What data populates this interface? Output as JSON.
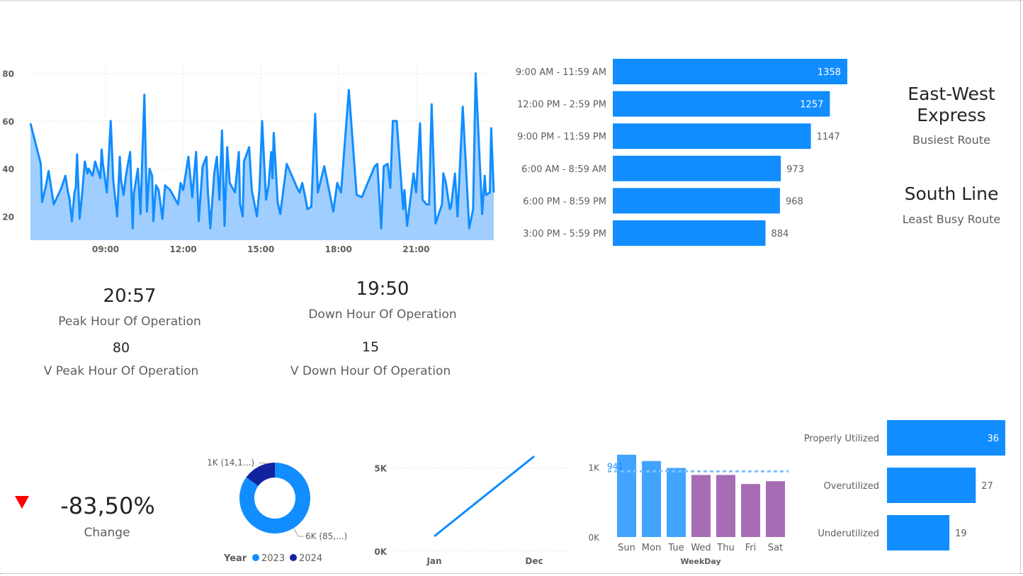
{
  "colors": {
    "primary": "#118DFF",
    "area_fill": "#A0CFFF",
    "dark_blue": "#12239E",
    "purple": "#A66CB4",
    "light_blue": "#41A4FF",
    "down_arrow": "#FF0000",
    "average_line": "#7CC0FF"
  },
  "routes": {
    "busiest": {
      "name": "East-West Express",
      "label": "Busiest Route"
    },
    "least_busy": {
      "name": "South Line",
      "label": "Least Busy Route"
    }
  },
  "kpis": {
    "peak_hour": {
      "value": "20:57",
      "label": "Peak Hour Of Operation"
    },
    "down_hour": {
      "value": "19:50",
      "label": "Down Hour Of Operation"
    },
    "v_peak": {
      "value": "80",
      "label": "V Peak Hour Of Operation"
    },
    "v_down": {
      "value": "15",
      "label": "V Down Hour Of Operation"
    },
    "change": {
      "value": "-83,50%",
      "label": "Change",
      "arrow_icon": "down-triangle-icon"
    }
  },
  "chart_data": [
    {
      "id": "hourly",
      "type": "area",
      "x_range": [
        6.1,
        24.0
      ],
      "ylim": [
        10,
        84
      ],
      "yticks": [
        20,
        40,
        60,
        80
      ],
      "xticks": [
        9,
        12,
        15,
        18,
        21
      ],
      "xtick_labels": [
        "09:00",
        "12:00",
        "15:00",
        "18:00",
        "21:00"
      ],
      "grid": true,
      "x": [
        6.1,
        6.5,
        6.55,
        6.7,
        6.8,
        7.0,
        7.3,
        7.45,
        7.55,
        7.6,
        7.7,
        7.8,
        7.85,
        7.9,
        8.0,
        8.1,
        8.2,
        8.3,
        8.35,
        8.5,
        8.6,
        8.8,
        8.85,
        8.9,
        9.05,
        9.2,
        9.3,
        9.45,
        9.55,
        9.6,
        9.7,
        9.8,
        9.95,
        10.05,
        10.1,
        10.25,
        10.35,
        10.45,
        10.5,
        10.6,
        10.7,
        10.8,
        10.85,
        10.95,
        11.05,
        11.1,
        11.2,
        11.3,
        11.5,
        11.8,
        11.9,
        12.0,
        12.2,
        12.35,
        12.5,
        12.6,
        12.75,
        12.9,
        12.95,
        13.05,
        13.2,
        13.3,
        13.4,
        13.5,
        13.6,
        13.7,
        13.8,
        14.0,
        14.15,
        14.2,
        14.3,
        14.35,
        14.55,
        14.65,
        14.85,
        14.95,
        15.05,
        15.2,
        15.3,
        15.4,
        15.45,
        15.5,
        15.65,
        15.75,
        16.0,
        16.4,
        16.5,
        16.6,
        16.7,
        16.8,
        16.95,
        17.1,
        17.2,
        17.45,
        17.8,
        17.95,
        18.1,
        18.4,
        18.7,
        18.9,
        19.4,
        19.5,
        19.65,
        19.75,
        19.9,
        20.0,
        20.1,
        20.25,
        20.5,
        20.55,
        20.65,
        20.8,
        20.9,
        21.0,
        21.15,
        21.25,
        21.4,
        21.5,
        21.55,
        21.6,
        21.75,
        22.0,
        22.05,
        22.15,
        22.3,
        22.35,
        22.5,
        22.6,
        22.7,
        22.8,
        23.05,
        23.2,
        23.3,
        23.55,
        23.65,
        23.7,
        23.85,
        23.9,
        24.0
      ],
      "values": [
        59,
        42,
        26,
        33,
        39,
        25,
        32,
        37,
        30,
        28,
        18,
        30,
        32,
        46,
        19,
        30,
        43,
        38,
        40,
        37,
        43,
        36,
        48,
        42,
        30,
        60,
        35,
        20,
        45,
        35,
        29,
        38,
        47,
        15,
        30,
        40,
        21,
        54,
        71,
        22,
        40,
        37,
        18,
        33,
        31,
        27,
        19,
        33,
        31,
        25,
        34,
        31,
        45,
        28,
        47,
        18,
        41,
        45,
        31,
        15,
        38,
        45,
        27,
        56,
        16,
        49,
        34,
        30,
        47,
        25,
        20,
        43,
        49,
        31,
        20,
        32,
        60,
        27,
        33,
        47,
        36,
        55,
        26,
        21,
        42,
        32,
        30,
        34,
        29,
        23,
        24,
        63,
        30,
        41,
        22,
        34,
        30,
        73,
        29,
        28,
        41,
        42,
        15,
        41,
        42,
        32,
        60,
        60,
        23,
        31,
        16,
        29,
        38,
        30,
        59,
        27,
        25,
        25,
        47,
        67,
        17,
        25,
        38,
        34,
        23,
        24,
        38,
        20,
        43,
        66,
        15,
        23,
        80,
        21,
        37,
        29,
        30,
        57,
        30,
        20,
        58,
        40,
        35
      ],
      "ylabel": "",
      "xlabel": ""
    },
    {
      "id": "time-slots",
      "type": "bar",
      "orientation": "horizontal",
      "categories": [
        "9:00 AM - 11:59 AM",
        "12:00 PM - 2:59 PM",
        "9:00 PM - 11:59 PM",
        "6:00 AM - 8:59 AM",
        "6:00 PM - 8:59 PM",
        "3:00 PM - 5:59 PM"
      ],
      "values": [
        1358,
        1257,
        1147,
        973,
        968,
        884
      ],
      "labels": [
        "1358",
        "1257",
        "1147",
        "973",
        "968",
        "884"
      ],
      "max": 1358
    },
    {
      "id": "year-donut",
      "type": "pie",
      "donut": true,
      "legend": {
        "title": "Year",
        "position": "bottom"
      },
      "series": [
        {
          "name": "2023",
          "value": 85,
          "label": "6K (85,...)"
        },
        {
          "name": "2024",
          "value": 15,
          "label": "1K (14,1...)"
        }
      ]
    },
    {
      "id": "monthly-line",
      "type": "line",
      "categories": [
        "Jan",
        "Dec"
      ],
      "values": [
        900,
        5700
      ],
      "ylim": [
        0,
        6300
      ],
      "ytick_values": [
        0,
        5000
      ],
      "ytick_labels": [
        "0K",
        "5K"
      ],
      "grid": true
    },
    {
      "id": "weekday",
      "type": "bar",
      "categories": [
        "Sun",
        "Mon",
        "Tue",
        "Wed",
        "Thu",
        "Fri",
        "Sat"
      ],
      "values": [
        1180,
        1090,
        990,
        890,
        890,
        760,
        800
      ],
      "bar_colors": [
        "#41A4FF",
        "#41A4FF",
        "#41A4FF",
        "#A66CB4",
        "#A66CB4",
        "#A66CB4",
        "#A66CB4"
      ],
      "average": 941,
      "average_label": "941",
      "ylim": [
        0,
        1300
      ],
      "ytick_values": [
        0,
        1000
      ],
      "ytick_labels": [
        "0K",
        "1K"
      ],
      "xlabel": "WeekDay"
    },
    {
      "id": "utilization",
      "type": "bar",
      "orientation": "horizontal",
      "categories": [
        "Properly Utilized",
        "Overutilized",
        "Underutilized"
      ],
      "values": [
        36,
        27,
        19
      ],
      "labels": [
        "36",
        "27",
        "19"
      ],
      "max": 36
    }
  ]
}
